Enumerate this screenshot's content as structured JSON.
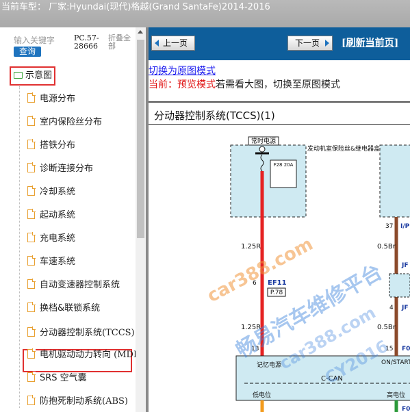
{
  "header": {
    "title": "当前车型： 厂家:Hyundai(现代)格越(Grand SantaFe)2014-2016"
  },
  "sidebar": {
    "search_placeholder": "输入关键字",
    "search_button": "查询",
    "pc_number": "PC.57-28666",
    "collapse_all": "折叠全部",
    "root_label": "示意图",
    "items": [
      {
        "label": "电源分布"
      },
      {
        "label": "室内保险丝分布"
      },
      {
        "label": "搭铁分布"
      },
      {
        "label": "诊断连接分布"
      },
      {
        "label": "冷却系统"
      },
      {
        "label": "起动系统"
      },
      {
        "label": "充电系统"
      },
      {
        "label": "车速系统"
      },
      {
        "label": "自动变速器控制系统"
      },
      {
        "label": "换档&联锁系统"
      },
      {
        "label": "分动器控制系统(TCCS)"
      },
      {
        "label": "电机驱动动力转向 (MDP"
      },
      {
        "label": "SRS 空气囊"
      },
      {
        "label": "防抱死制动系统(ABS)"
      }
    ],
    "selected_index": 10
  },
  "toolbar": {
    "prev_label": "上一页",
    "next_label": "下一页",
    "refresh_label": "[刷新当前页]"
  },
  "content": {
    "switch_link": "切换为原图模式",
    "mode_prefix": "当前：",
    "mode_value": "预览模式",
    "mode_suffix": "若需看大图，切换至原图模式",
    "diagram_title": "分动器控制系统(TCCS)(1)"
  },
  "diagram": {
    "label_constant_power": "常时电源",
    "label_fuse_box": "发动机室保险丝&继电器盒",
    "label_fuse": "F28 20A",
    "label_wire_1": "1.25R",
    "label_connector": "EF11",
    "label_page_ref": "P.78",
    "label_wire_2": "1.25R",
    "label_pin_6": "6",
    "label_pin_13": "13",
    "label_memory_power": "记忆电源",
    "label_ccan": "C-CAN",
    "label_low": "低电位",
    "label_high": "高电位",
    "label_pin_37": "37",
    "label_ip": "I/P",
    "label_wire_3": "0.5Br",
    "label_jf_1": "JF",
    "label_pin_4": "4",
    "label_jf_2": "JF",
    "label_wire_4": "0.5Br",
    "label_pin_15": "15",
    "label_fo": "F0",
    "label_onstart": "ON/START输入",
    "label_fo_2": "F0",
    "colors": {
      "wire_red": "#e52222",
      "wire_brown": "#8b4a2b",
      "fuse_box": "#cfeaf2",
      "ecu_box": "#cfeaf2"
    }
  },
  "watermarks": {
    "wm_1": "car388.com",
    "wm_2": "畅易汽车维修平台",
    "wm_3": "car388.com",
    "wm_4": "CY2016"
  }
}
